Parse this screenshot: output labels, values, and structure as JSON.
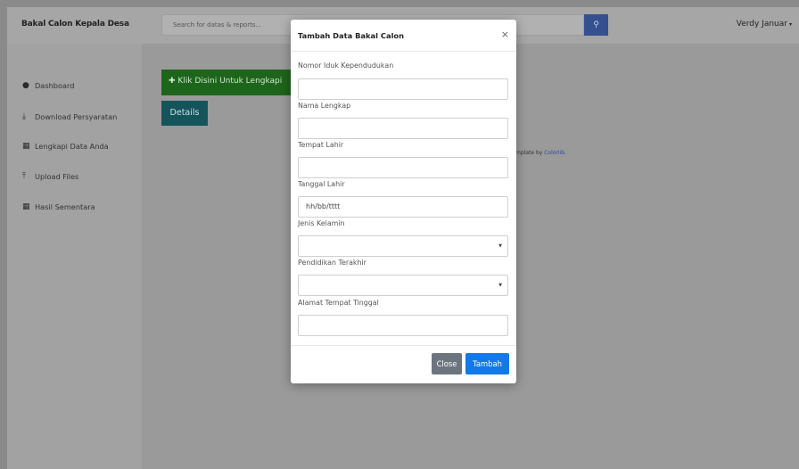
{
  "header": {
    "brand": "Bakal Calon Kepala Desa",
    "search_placeholder": "Search for datas & reports...",
    "search_icon": "search-icon",
    "user_name": "Verdy Januar",
    "user_caret": "▾"
  },
  "sidebar": {
    "items": [
      {
        "label": "Dashboard",
        "icon": "map-marker-icon",
        "glyph": "📍"
      },
      {
        "label": "Download Persyaratan",
        "icon": "download-icon",
        "glyph": "⤓"
      },
      {
        "label": "Lengkapi Data Anda",
        "icon": "calendar-icon",
        "glyph": "▦"
      },
      {
        "label": "Upload Files",
        "icon": "upload-icon",
        "glyph": "⤒"
      },
      {
        "label": "Hasil Sementara",
        "icon": "calendar-icon",
        "glyph": "▦"
      }
    ]
  },
  "main": {
    "action_button": "Klik Disini Untuk Lengkapi",
    "action_icon": "plus-icon",
    "details_button": "Details",
    "credit_text": "mplate by ",
    "credit_link": "Colorlib."
  },
  "modal": {
    "title": "Tambah Data Bakal Calon",
    "close_symbol": "×",
    "fields": [
      {
        "label": "Nomor Iduk Kependudukan",
        "type": "text",
        "value": ""
      },
      {
        "label": "Nama Lengkap",
        "type": "text",
        "value": ""
      },
      {
        "label": "Tempat Lahir",
        "type": "text",
        "value": ""
      },
      {
        "label": "Tanggal Lahir",
        "type": "date",
        "value": "hh/bb/tttt"
      },
      {
        "label": "Jenis Kelamin",
        "type": "select",
        "value": ""
      },
      {
        "label": "Pendidikan Terakhir",
        "type": "select",
        "value": ""
      },
      {
        "label": "Alamat Tempat Tinggal",
        "type": "text",
        "value": ""
      }
    ],
    "close_button": "Close",
    "submit_button": "Tambah"
  },
  "colors": {
    "primary": "#1479e8",
    "secondary": "#6c757d",
    "success": "#28a745",
    "teal": "#17a2b8",
    "search_button": "#4e73df"
  }
}
